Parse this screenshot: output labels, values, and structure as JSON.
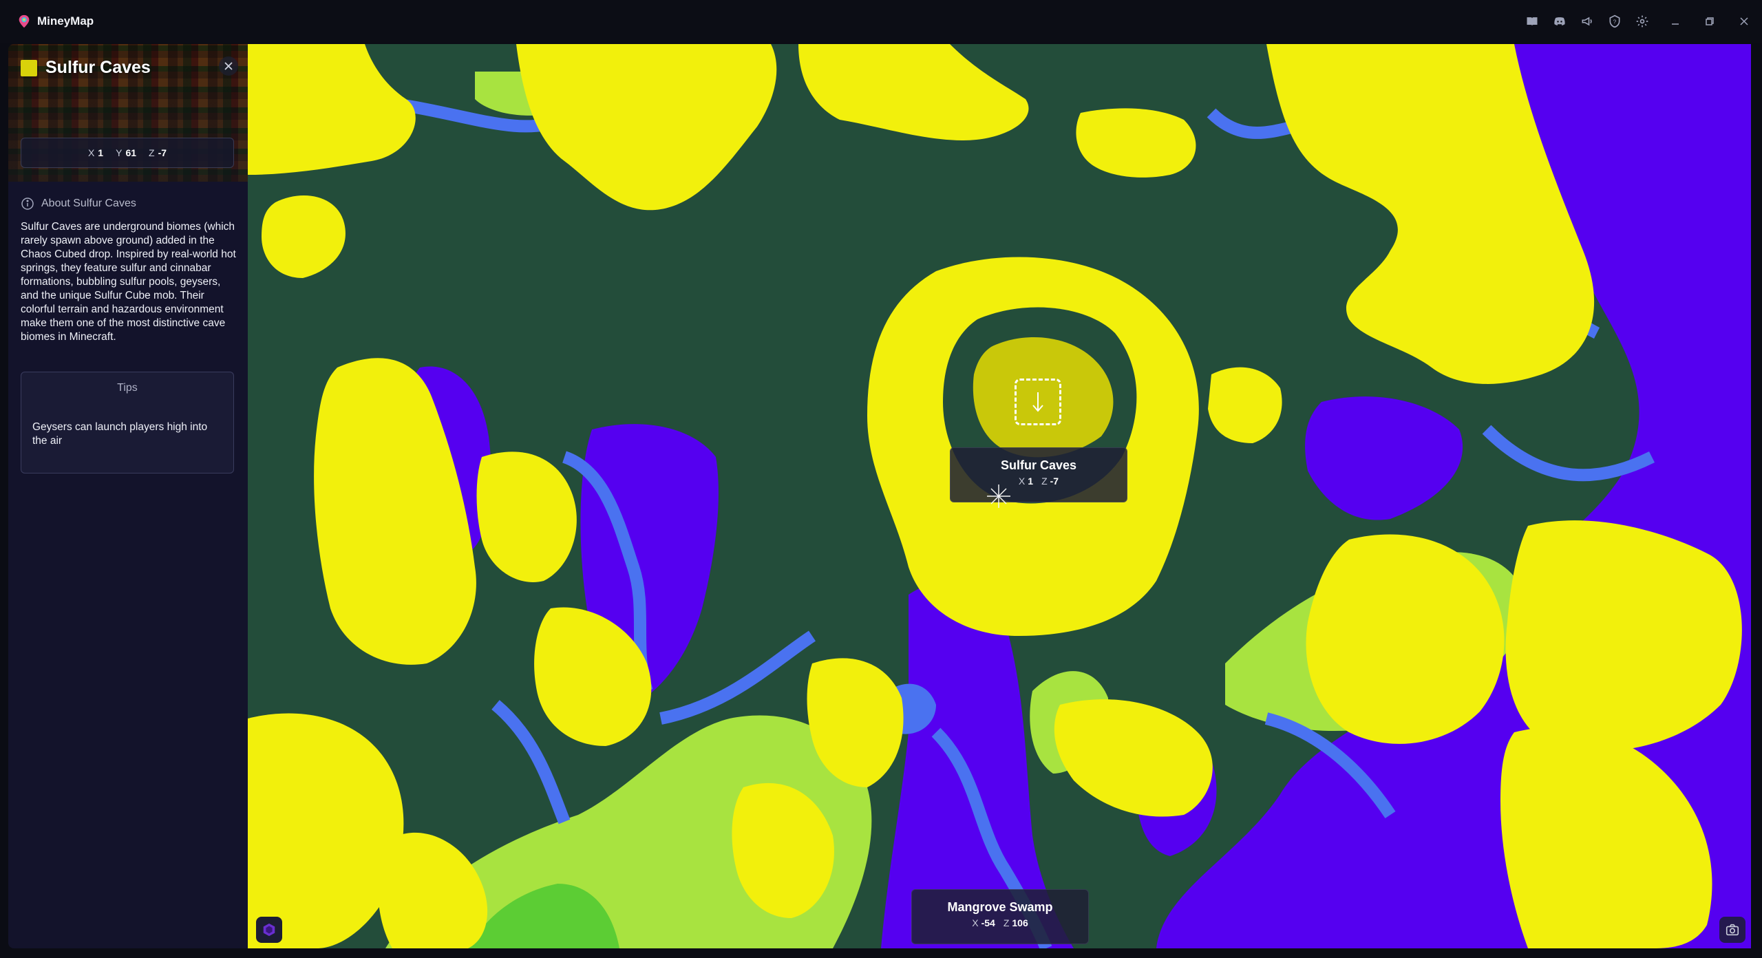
{
  "app": {
    "name": "MineyMap"
  },
  "titlebar": {
    "icons": [
      "book-icon",
      "discord-icon",
      "announcements-icon",
      "help-icon",
      "settings-icon"
    ],
    "window_controls": [
      "minimize-icon",
      "restore-icon",
      "close-icon"
    ]
  },
  "sidebar": {
    "biome_name": "Sulfur Caves",
    "biome_color": "#d9d20a",
    "coords": {
      "x_label": "X",
      "x": "1",
      "y_label": "Y",
      "y": "61",
      "z_label": "Z",
      "z": "-7"
    },
    "about_label": "About Sulfur Caves",
    "about_text": "Sulfur Caves are underground biomes (which rarely spawn above ground) added in the Chaos Cubed drop. Inspired by real-world hot springs, they feature sulfur and cinnabar formations, bubbling sulfur pools, geysers, and the unique Sulfur Cube mob. Their colorful terrain and hazardous environment make them one of the most distinctive cave biomes in Minecraft.",
    "tips_title": "Tips",
    "tips_text": "Geysers can launch players high into the air"
  },
  "map": {
    "selected": {
      "name": "Sulfur Caves",
      "x_label": "X",
      "x": "1",
      "z_label": "Z",
      "z": "-7"
    },
    "cursor": {
      "name": "Mangrove Swamp",
      "x_label": "X",
      "x": "-54",
      "z_label": "Z",
      "z": "106"
    },
    "colors": {
      "dark_forest": "#234d3a",
      "sulfur": "#f2f00c",
      "water": "#4a72f0",
      "purple": "#5500f0",
      "lime": "#a8e340",
      "green": "#5ccd34",
      "selected": "#c9c80a"
    }
  }
}
